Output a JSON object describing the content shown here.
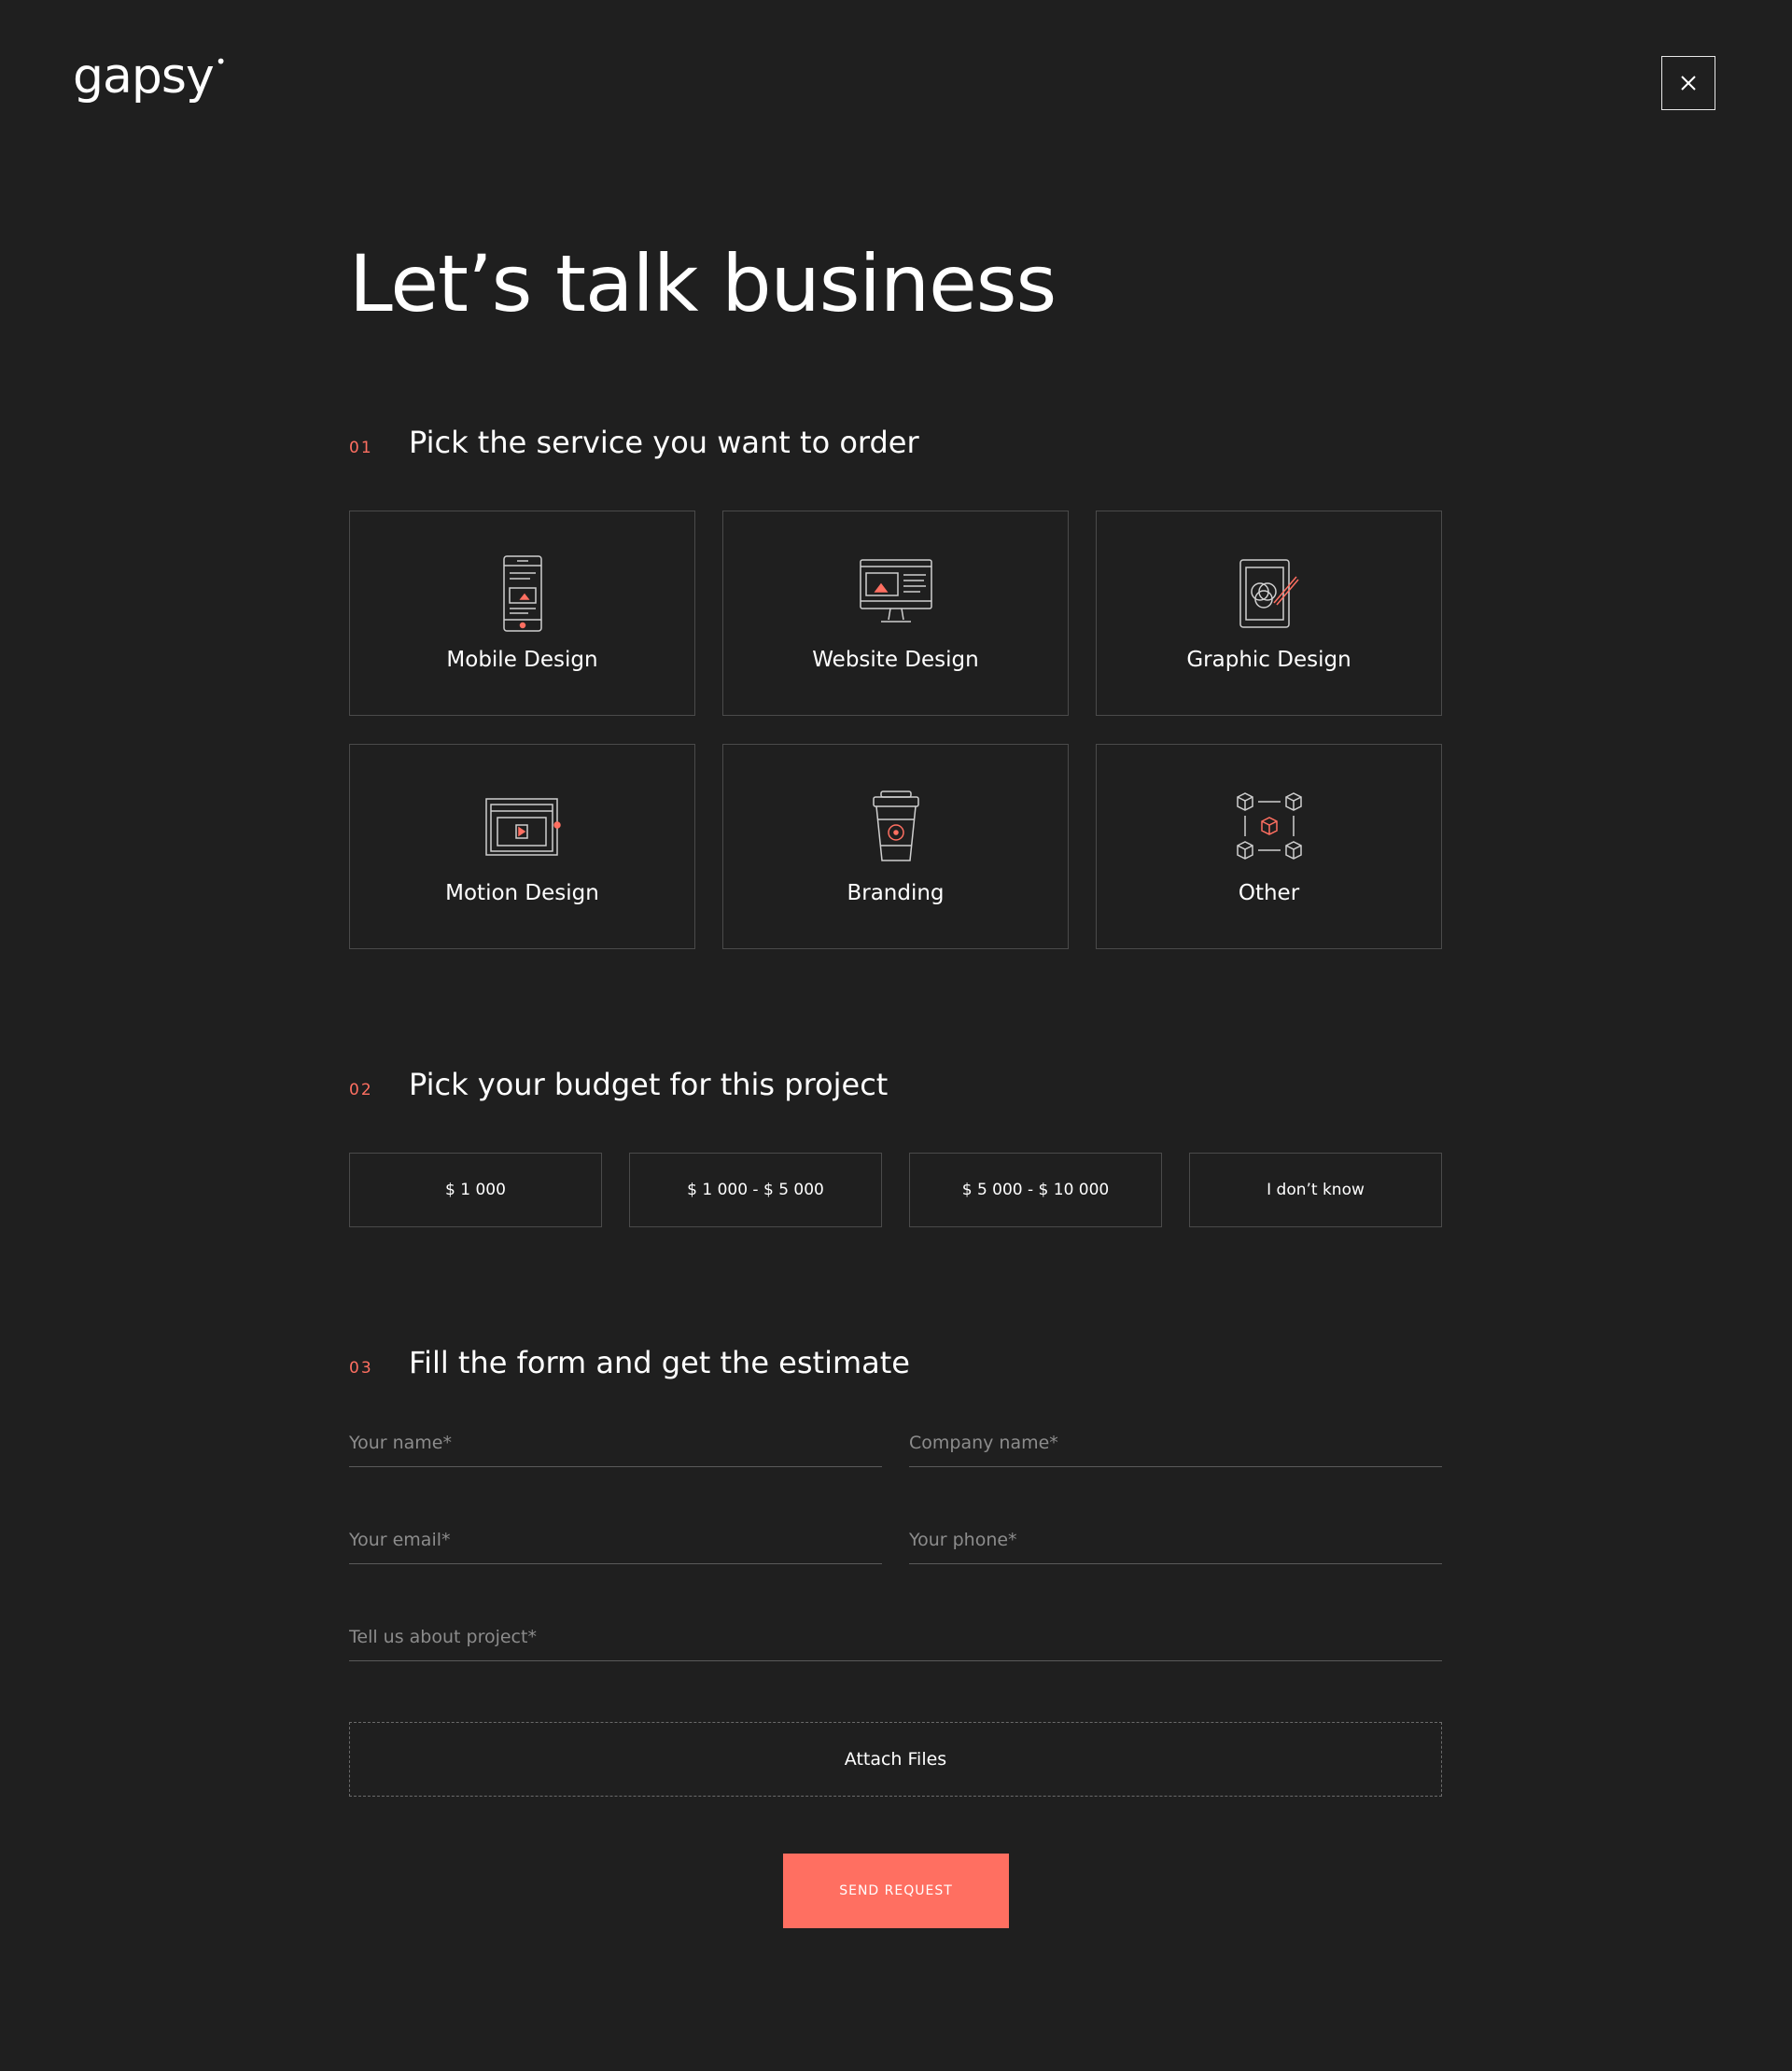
{
  "header": {
    "logo_text": "gapsy",
    "close_icon": "close-icon"
  },
  "title": "Let’s talk business",
  "sections": [
    {
      "number": "01",
      "title": "Pick the service you want to order"
    },
    {
      "number": "02",
      "title": "Pick your budget for this project"
    },
    {
      "number": "03",
      "title": "Fill the form and get the estimate"
    }
  ],
  "services": [
    {
      "label": "Mobile Design",
      "icon": "mobile-phone-icon"
    },
    {
      "label": "Website Design",
      "icon": "desktop-monitor-icon"
    },
    {
      "label": "Graphic Design",
      "icon": "tablet-pen-icon"
    },
    {
      "label": "Motion Design",
      "icon": "video-player-icon"
    },
    {
      "label": "Branding",
      "icon": "coffee-cup-icon"
    },
    {
      "label": "Other",
      "icon": "cubes-network-icon"
    }
  ],
  "budgets": [
    "$ 1 000",
    "$ 1 000 - $ 5 000",
    "$ 5 000 - $ 10 000",
    "I don’t know"
  ],
  "form": {
    "name_placeholder": "Your name*",
    "company_placeholder": "Company name*",
    "email_placeholder": "Your email*",
    "phone_placeholder": "Your phone*",
    "project_placeholder": "Tell us about project*",
    "attach_label": "Attach Files",
    "submit_label": "SEND REQUEST"
  },
  "colors": {
    "background": "#1f1f1f",
    "accent": "#ff6f61",
    "border": "#4a4a4a",
    "text": "#ffffff",
    "placeholder": "#8c8c8c"
  }
}
